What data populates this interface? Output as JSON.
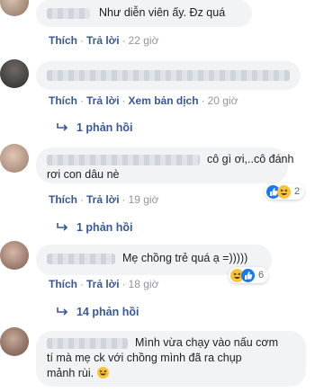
{
  "colors": {
    "link": "#385898",
    "meta": "#90949c",
    "bubble": "#f2f3f5"
  },
  "comments": [
    {
      "text": "Như diễn viên ấy. Đz quá",
      "actions": [
        "Thích",
        "Trả lời"
      ],
      "time": "22 giờ"
    },
    {
      "text": "",
      "actions": [
        "Thích",
        "Trả lời",
        "Xem bản dịch"
      ],
      "time": "20 giờ",
      "replies": "1 phản hồi"
    },
    {
      "text_line1": "cô gì ơi,..cô đánh",
      "text_line2": "rơi con dâu nè",
      "actions": [
        "Thích",
        "Trả lời"
      ],
      "time": "19 giờ",
      "reaction_count": "2",
      "replies": "1 phản hồi"
    },
    {
      "text": "Mẹ chồng trẻ quá ạ =)))))",
      "actions": [
        "Thích",
        "Trả lời"
      ],
      "time": "18 giờ",
      "reaction_count": "6",
      "replies": "14 phản hồi"
    },
    {
      "text_line1": "Mình vừa chạy vào nấu cơm",
      "text_line2": "tí mà mẹ ck với chồng mình đã ra chụp",
      "text_line3": "mảnh rùi."
    }
  ]
}
